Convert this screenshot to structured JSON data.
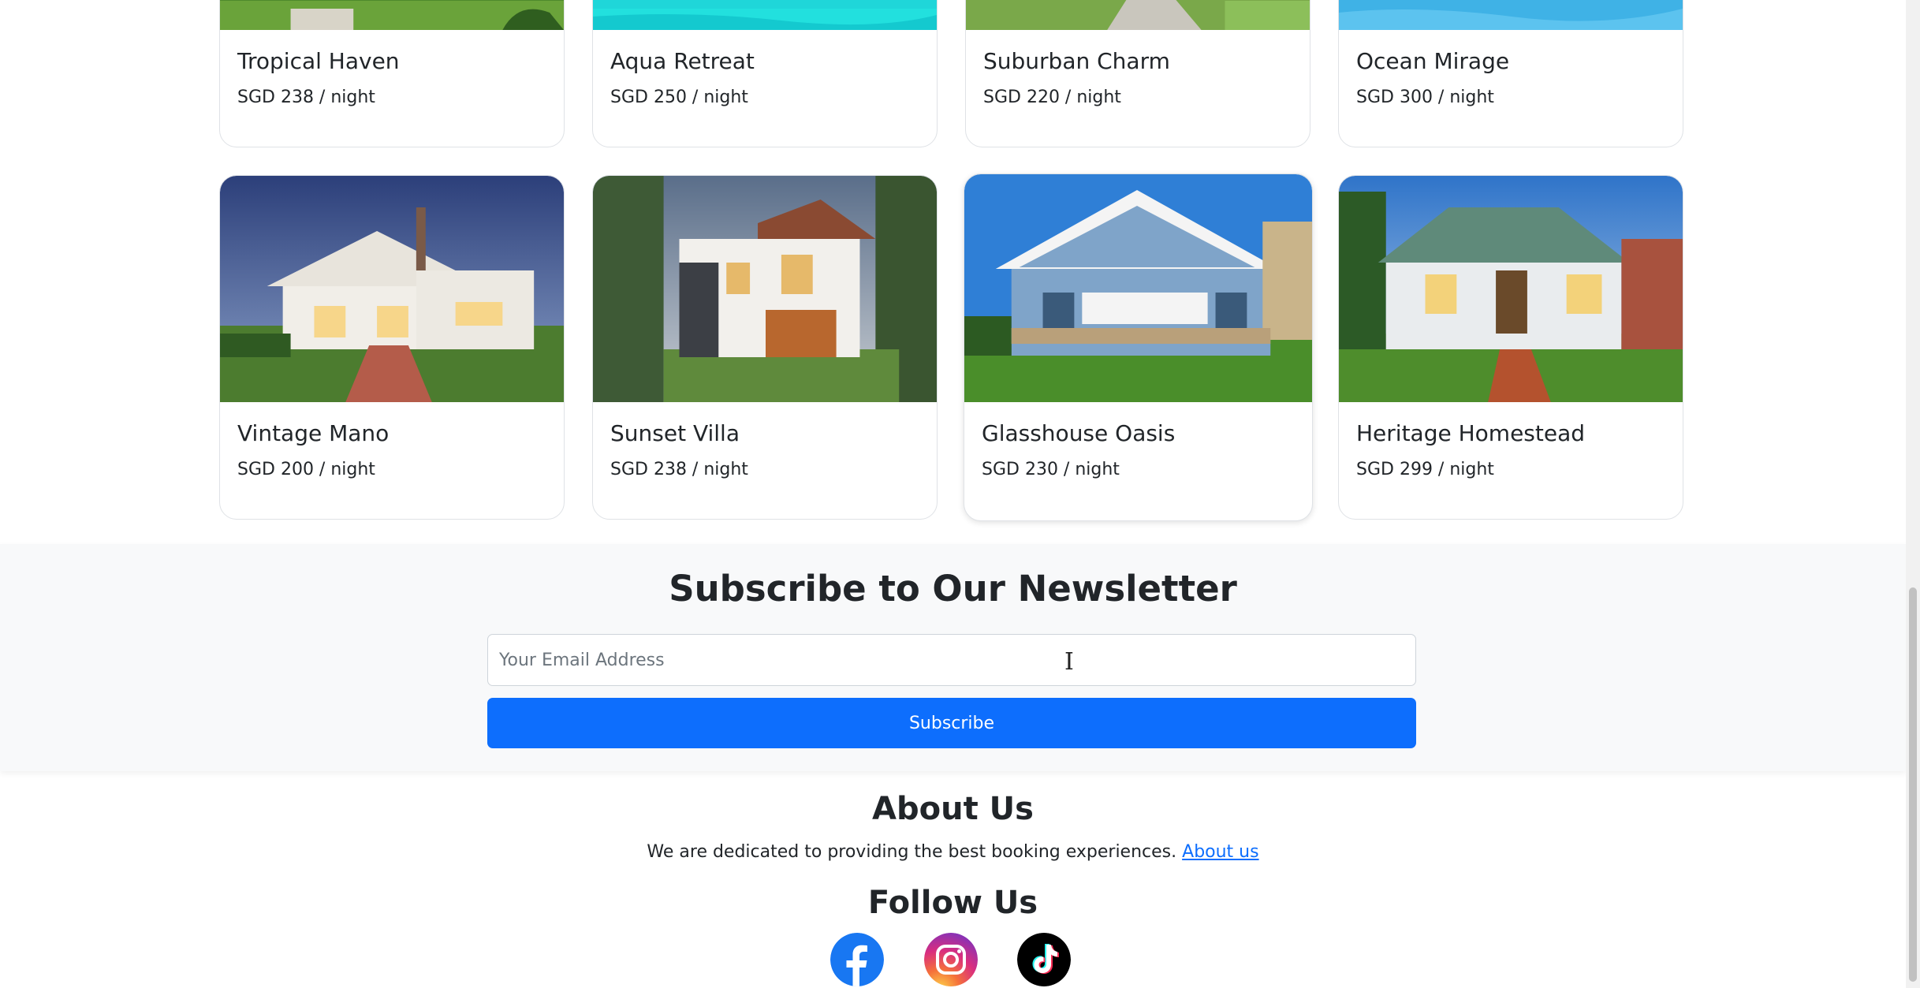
{
  "listings_top": [
    {
      "name": "Tropical Haven",
      "price": "SGD 238 / night"
    },
    {
      "name": "Aqua Retreat",
      "price": "SGD 250 / night"
    },
    {
      "name": "Suburban Charm",
      "price": "SGD 220 / night"
    },
    {
      "name": "Ocean Mirage",
      "price": "SGD 300 / night"
    }
  ],
  "listings_bottom": [
    {
      "name": "Vintage Mano",
      "price": "SGD 200 / night"
    },
    {
      "name": "Sunset Villa",
      "price": "SGD 238 / night"
    },
    {
      "name": "Glasshouse Oasis",
      "price": "SGD 230 / night"
    },
    {
      "name": "Heritage Homestead",
      "price": "SGD 299 / night"
    }
  ],
  "newsletter": {
    "title": "Subscribe to Our Newsletter",
    "email_placeholder": "Your Email Address",
    "email_value": "",
    "button_label": "Subscribe"
  },
  "about": {
    "title": "About Us",
    "text": "We are dedicated to providing the best booking experiences.",
    "link_label": "About us"
  },
  "follow": {
    "title": "Follow Us",
    "icons": [
      "facebook-icon",
      "instagram-icon",
      "tiktok-icon"
    ]
  },
  "colors": {
    "primary": "#0d6efd",
    "newsletter_bg": "#f8f9fa",
    "text": "#212529",
    "facebook": "#1877f2"
  }
}
